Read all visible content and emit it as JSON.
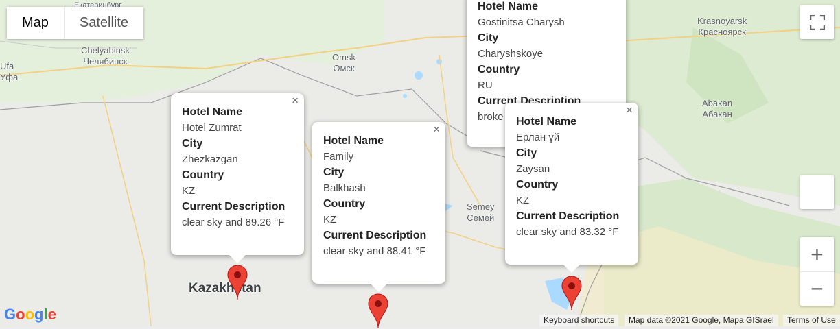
{
  "map_type": {
    "map_label": "Map",
    "satellite_label": "Satellite",
    "selected": "Map"
  },
  "places": [
    {
      "name": "Chelyabinsk",
      "name_ru": "Челябинск"
    },
    {
      "name": "Omsk",
      "name_ru": "Омск"
    },
    {
      "name": "Krasnoyarsk",
      "name_ru": "Красноярск"
    },
    {
      "name": "Abakan",
      "name_ru": "Абакан"
    },
    {
      "name": "Semey",
      "name_ru": "Семей"
    },
    {
      "name": "Kazakhstan"
    },
    {
      "name": "Ufa",
      "name_ru": "Уфа"
    },
    {
      "name": "Екатеринбург"
    }
  ],
  "info_windows": [
    {
      "hotel_label": "Hotel Name",
      "hotel": "Hotel Zumrat",
      "city_label": "City",
      "city": "Zhezkazgan",
      "country_label": "Country",
      "country": "KZ",
      "desc_label": "Current Description",
      "desc": "clear sky and 89.26 °F"
    },
    {
      "hotel_label": "Hotel Name",
      "hotel": "Family",
      "city_label": "City",
      "city": "Balkhash",
      "country_label": "Country",
      "country": "KZ",
      "desc_label": "Current Description",
      "desc": "clear sky and 88.41 °F"
    },
    {
      "hotel_label": "Hotel Name",
      "hotel": "Gostinitsa Charysh",
      "city_label": "City",
      "city": "Charyshskoye",
      "country_label": "Country",
      "country": "RU",
      "desc_label": "Current Description",
      "desc": "broke"
    },
    {
      "hotel_label": "Hotel Name",
      "hotel": "Ерлан үй",
      "city_label": "City",
      "city": "Zaysan",
      "country_label": "Country",
      "country": "KZ",
      "desc_label": "Current Description",
      "desc": "clear sky and 83.32 °F"
    }
  ],
  "close_glyph": "×",
  "zoom_in": "+",
  "zoom_out": "−",
  "attribution": {
    "shortcuts": "Keyboard shortcuts",
    "map_data": "Map data ©2021 Google, Mapa GISrael",
    "terms": "Terms of Use"
  },
  "google_logo": "Google",
  "colors": {
    "land": "#ececec",
    "water": "#aadaff",
    "road": "#f8d37a",
    "marker": "#ea4335",
    "green": "#cde8c2"
  },
  "icons": {
    "fullscreen": "fullscreen-icon",
    "marker": "map-marker-icon"
  }
}
